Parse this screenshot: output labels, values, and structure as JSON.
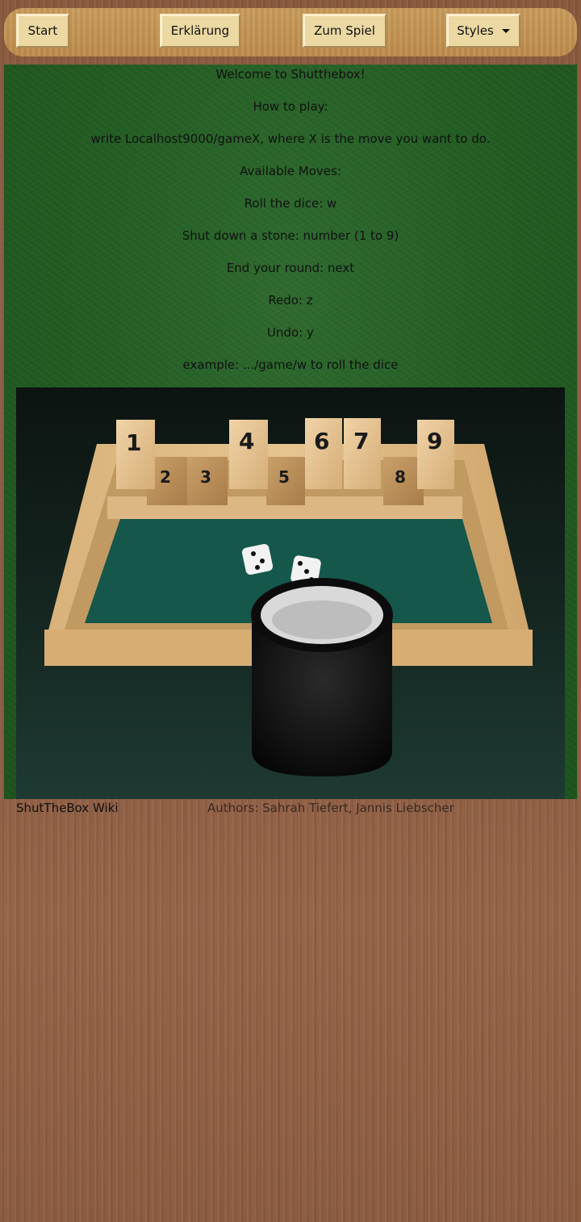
{
  "nav": {
    "start": "Start",
    "explanation": "Erklärung",
    "to_game": "Zum Spiel",
    "styles": "Styles"
  },
  "content": {
    "lines": [
      "Welcome to Shutthebox!",
      "How to play:",
      "write Localhost9000/gameX, where X is the move you want to do.",
      "Available Moves:",
      "Roll the dice: w",
      "Shut down a stone: number (1 to 9)",
      "End your round: next",
      "Redo: z",
      "Undo: y",
      "example: .../game/w to roll the dice"
    ]
  },
  "photo": {
    "tiles_up": [
      "1",
      "4",
      "6",
      "7",
      "9"
    ],
    "tiles_down": [
      "2",
      "3",
      "5",
      "8"
    ]
  },
  "footer": {
    "wiki_link": "ShutTheBox Wiki",
    "authors": "Authors: Sahrah Tiefert, Jannis Liebscher"
  },
  "colors": {
    "wood_background": "#8d5d42",
    "navbar": "#c99b5b",
    "button": "#ebd8a2",
    "felt_green": "#245e24"
  }
}
